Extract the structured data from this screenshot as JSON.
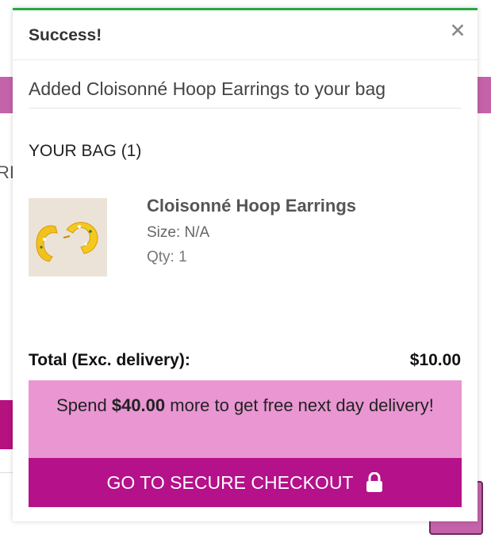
{
  "toast": {
    "title": "Success!",
    "close_symbol": "✖",
    "message": "Added Cloisonné Hoop Earrings to your bag"
  },
  "bag": {
    "heading": "YOUR BAG (1)",
    "items": [
      {
        "name": "Cloisonné Hoop Earrings",
        "size": "Size: N/A",
        "qty": "Qty: 1",
        "image_icon": "earrings-photo"
      }
    ],
    "total_label": "Total (Exc. delivery):",
    "total_value": "$10.00"
  },
  "promo": {
    "prefix": "Spend ",
    "amount": "$40.00",
    "suffix": " more to get free next day delivery!"
  },
  "checkout": {
    "label": "GO TO SECURE CHECKOUT",
    "icon": "lock-icon"
  },
  "background": {
    "partial_text": "RI",
    "accent_color": "#c463a9",
    "button_color": "#b5118a",
    "promo_color": "#e996d2",
    "success_color": "#28a745"
  }
}
